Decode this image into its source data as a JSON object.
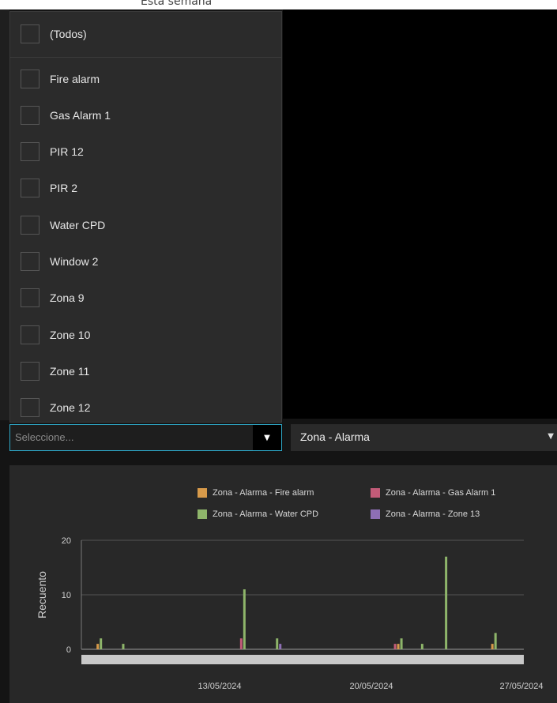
{
  "topFragment": "Esta semana",
  "filterList": {
    "allLabel": "(Todos)",
    "items": [
      "Fire alarm",
      "Gas Alarm 1",
      "PIR 12",
      "PIR 2",
      "Water CPD",
      "Window 2",
      "Zona 9",
      "Zone 10",
      "Zone 11",
      "Zone 12"
    ]
  },
  "selectors": {
    "left": {
      "placeholder": "Seleccione..."
    },
    "right": {
      "value": "Zona - Alarma"
    }
  },
  "chart_data": {
    "type": "bar",
    "ylabel": "Recuento",
    "ylim": [
      0,
      20
    ],
    "yticks": [
      0,
      10,
      20
    ],
    "x_tick_labels": [
      "13/05/2024",
      "20/05/2024",
      "27/05/2024"
    ],
    "legend": [
      {
        "name": "Zona - Alarma - Fire alarm",
        "color": "#d79a4a"
      },
      {
        "name": "Zona - Alarma - Gas Alarm 1",
        "color": "#c25b78"
      },
      {
        "name": "Zona - Alarma - Water CPD",
        "color": "#8eb56a"
      },
      {
        "name": "Zona - Alarma - Zone 13",
        "color": "#8e6fb5"
      }
    ],
    "bars": [
      {
        "slot": 1,
        "series": "Zona - Alarma - Fire alarm",
        "value": 1
      },
      {
        "slot": 1,
        "series": "Zona - Alarma - Water CPD",
        "value": 2
      },
      {
        "slot": 3,
        "series": "Zona - Alarma - Water CPD",
        "value": 1
      },
      {
        "slot": 13,
        "series": "Zona - Alarma - Gas Alarm 1",
        "value": 2
      },
      {
        "slot": 13,
        "series": "Zona - Alarma - Water CPD",
        "value": 11
      },
      {
        "slot": 16,
        "series": "Zona - Alarma - Water CPD",
        "value": 2
      },
      {
        "slot": 16,
        "series": "Zona - Alarma - Zone 13",
        "value": 1
      },
      {
        "slot": 26,
        "series": "Zona - Alarma - Gas Alarm 1",
        "value": 1
      },
      {
        "slot": 26,
        "series": "Zona - Alarma - Fire alarm",
        "value": 1
      },
      {
        "slot": 26,
        "series": "Zona - Alarma - Water CPD",
        "value": 2
      },
      {
        "slot": 28,
        "series": "Zona - Alarma - Water CPD",
        "value": 1
      },
      {
        "slot": 30,
        "series": "Zona - Alarma - Water CPD",
        "value": 17
      },
      {
        "slot": 34,
        "series": "Zona - Alarma - Fire alarm",
        "value": 1
      },
      {
        "slot": 34,
        "series": "Zona - Alarma - Water CPD",
        "value": 3
      }
    ]
  }
}
